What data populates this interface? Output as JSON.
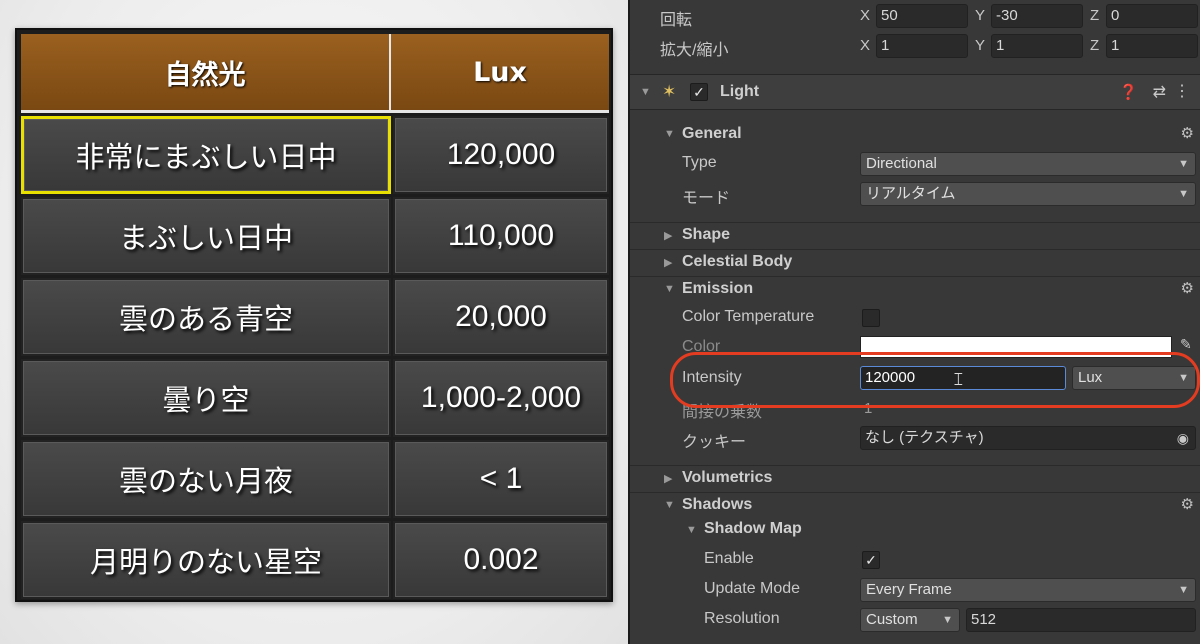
{
  "lux_table": {
    "header": {
      "col1": "自然光",
      "col2": "Lux"
    },
    "rows": [
      {
        "name": "非常にまぶしい日中",
        "lux": "120,000",
        "highlighted": true
      },
      {
        "name": "まぶしい日中",
        "lux": "110,000"
      },
      {
        "name": "雲のある青空",
        "lux": "20,000"
      },
      {
        "name": "曇り空",
        "lux": "1,000-2,000"
      },
      {
        "name": "雲のない月夜",
        "lux": "< 1"
      },
      {
        "name": "月明りのない星空",
        "lux": "0.002"
      }
    ]
  },
  "transform": {
    "rotation": {
      "label": "回転",
      "x": "50",
      "y": "-30",
      "z": "0"
    },
    "scale": {
      "label": "拡大/縮小",
      "x": "1",
      "y": "1",
      "z": "1"
    },
    "axis_x": "X",
    "axis_y": "Y",
    "axis_z": "Z"
  },
  "light_component": {
    "title": "Light",
    "enabled": true,
    "help_icon": "help-icon",
    "presets_icon": "sliders-icon",
    "menu_icon": "kebab-menu-icon"
  },
  "general": {
    "title": "General",
    "type_label": "Type",
    "type_value": "Directional",
    "mode_label": "モード",
    "mode_value": "リアルタイム"
  },
  "sections_collapsed": {
    "shape": "Shape",
    "celestial": "Celestial Body",
    "volumetrics": "Volumetrics"
  },
  "emission": {
    "title": "Emission",
    "color_temp_label": "Color Temperature",
    "color_label": "Color",
    "color_value": "#ffffff",
    "intensity_label": "Intensity",
    "intensity_value": "120000",
    "intensity_unit": "Lux",
    "indirect_label": "間接の乗数",
    "indirect_value": "1",
    "cookie_label": "クッキー",
    "cookie_value": "なし (テクスチャ)"
  },
  "shadows": {
    "title": "Shadows",
    "shadow_map_title": "Shadow Map",
    "enable_label": "Enable",
    "enable_checked": true,
    "update_mode_label": "Update Mode",
    "update_mode_value": "Every Frame",
    "resolution_label": "Resolution",
    "resolution_preset": "Custom",
    "resolution_value": "512"
  },
  "colors": {
    "header_brown": "#8a5419",
    "highlight_yellow": "#e8e000",
    "annotation_red": "#e33c20"
  }
}
